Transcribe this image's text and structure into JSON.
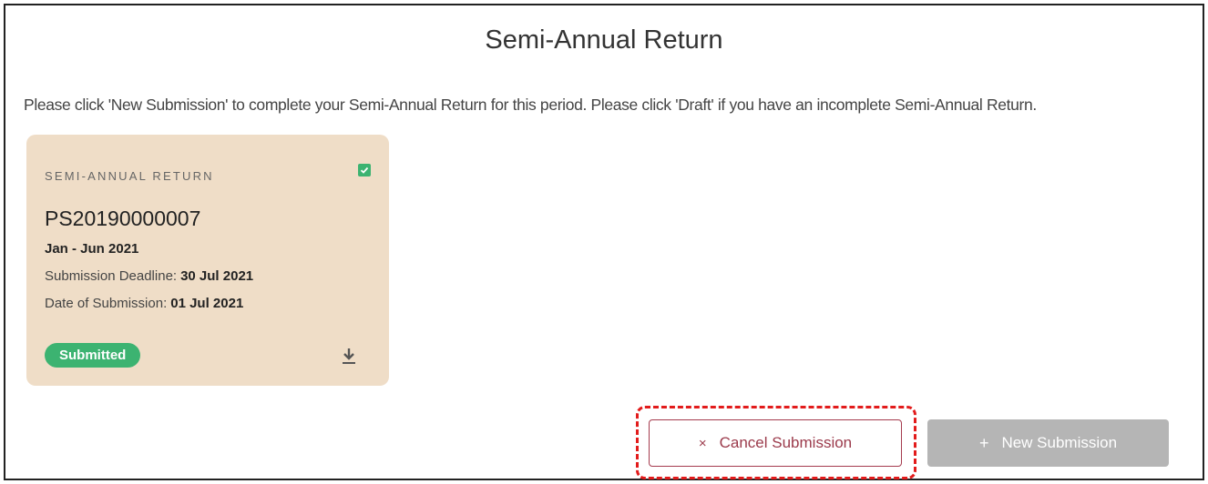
{
  "page": {
    "title": "Semi-Annual Return",
    "instructions": "Please click 'New Submission' to complete your Semi-Annual Return for this period. Please click 'Draft' if you have an incomplete Semi-Annual Return."
  },
  "card": {
    "category": "SEMI-ANNUAL RETURN",
    "checked": true,
    "reference": "PS20190000007",
    "period": "Jan - Jun 2021",
    "deadline_label": "Submission Deadline:",
    "deadline_value": "30 Jul 2021",
    "submission_label": "Date of Submission:",
    "submission_value": "01 Jul 2021",
    "status": "Submitted",
    "download_icon": "download-icon"
  },
  "actions": {
    "cancel_glyph": "×",
    "cancel_label": "Cancel Submission",
    "new_glyph": "+",
    "new_label": "New Submission"
  },
  "colors": {
    "card_background": "#efddc7",
    "status_green": "#3cb371",
    "cancel_accent": "#9b3a4b",
    "new_button_disabled": "#b5b5b5",
    "highlight": "#e21b1b"
  }
}
